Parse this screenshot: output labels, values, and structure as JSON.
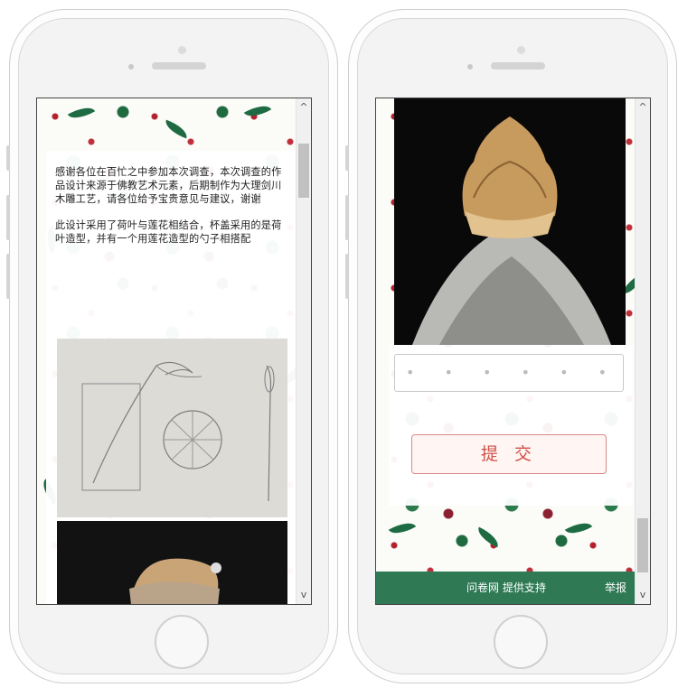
{
  "survey": {
    "intro_paragraph_1": "感谢各位在百忙之中参加本次调查，本次调查的作品设计来源于佛教艺术元素，后期制作为大理剑川木雕工艺，请各位给予宝贵意见与建议，谢谢",
    "intro_paragraph_2": " 此设计采用了荷叶与莲花相结合，杯盖采用的是荷叶造型，并有一个用莲花造型的勺子相搭配",
    "input_placeholder": "• • • • • •",
    "submit_label": "提 交"
  },
  "footer": {
    "support_text": "问卷网 提供支持",
    "report_link": "举报"
  },
  "scrollbar": {
    "up_arrow": "^",
    "down_arrow": "v"
  },
  "colors": {
    "footer_green": "#2f7a55",
    "submit_red": "#cf4f46",
    "holly_red": "#b2222c",
    "leaf_green": "#1e6b43"
  }
}
